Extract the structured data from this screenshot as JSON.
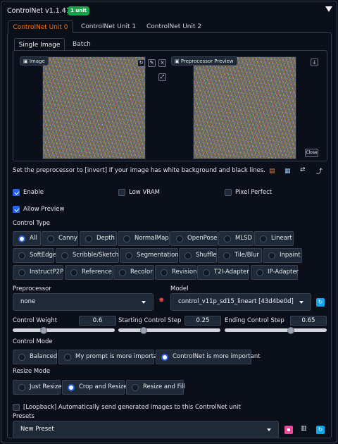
{
  "header": {
    "title": "ControlNet v1.1.410",
    "badge": "1 unit"
  },
  "unit_tabs": [
    "ControlNet Unit 0",
    "ControlNet Unit 1",
    "ControlNet Unit 2"
  ],
  "image_tabs": [
    "Single Image",
    "Batch"
  ],
  "image_panel": {
    "image_label": "Image",
    "preview_label": "Preprocessor Preview",
    "close_label": "Close"
  },
  "hint": "Set the preprocessor to [invert] If your image has white background and black lines.",
  "checkboxes": {
    "enable": "Enable",
    "low_vram": "Low VRAM",
    "pixel_perfect": "Pixel Perfect",
    "allow_preview": "Allow Preview",
    "loopback": "[Loopback] Automatically send generated images to this ControlNet unit"
  },
  "control_type": {
    "label": "Control Type",
    "selected": "All",
    "options": [
      "All",
      "Canny",
      "Depth",
      "NormalMap",
      "OpenPose",
      "MLSD",
      "Lineart",
      "SoftEdge",
      "Scribble/Sketch",
      "Segmentation",
      "Shuffle",
      "Tile/Blur",
      "Inpaint",
      "InstructP2P",
      "Reference",
      "Recolor",
      "Revision",
      "T2I-Adapter",
      "IP-Adapter"
    ]
  },
  "preprocessor": {
    "label": "Preprocessor",
    "value": "none"
  },
  "model": {
    "label": "Model",
    "value": "control_v11p_sd15_lineart [43d4be0d]"
  },
  "sliders": {
    "weight": {
      "label": "Control Weight",
      "value": "0.6",
      "fraction": 0.3
    },
    "start": {
      "label": "Starting Control Step",
      "value": "0.25",
      "fraction": 0.25
    },
    "end": {
      "label": "Ending Control Step",
      "value": "0.65",
      "fraction": 0.65
    }
  },
  "control_mode": {
    "label": "Control Mode",
    "selected": "ControlNet is more important",
    "options": [
      "Balanced",
      "My prompt is more important",
      "ControlNet is more important"
    ]
  },
  "resize_mode": {
    "label": "Resize Mode",
    "selected": "Crop and Resize",
    "options": [
      "Just Resize",
      "Crop and Resize",
      "Resize and Fill"
    ]
  },
  "presets": {
    "label": "Presets",
    "value": "New Preset"
  },
  "colors": {
    "accent": "#f97316",
    "badge": "#16a34a",
    "radio": "#2563eb",
    "save": "#ec4899",
    "refresh": "#0ea5e9"
  }
}
